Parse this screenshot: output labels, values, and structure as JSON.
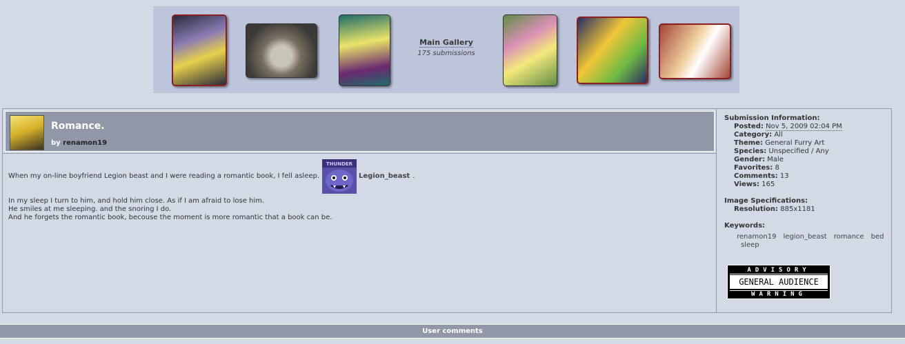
{
  "gallery": {
    "title": "Main Gallery",
    "count": "175 submissions",
    "thumbnails": [
      {
        "name": "thumb-1",
        "palette": [
          "#2a2c3a",
          "#e7d14a",
          "#8a7bb3"
        ]
      },
      {
        "name": "thumb-2",
        "palette": [
          "#3b3a36",
          "#c9c4b8",
          "#7a6f62"
        ]
      },
      {
        "name": "thumb-3",
        "palette": [
          "#1f6b6a",
          "#e9e46a",
          "#6a2a6f"
        ]
      },
      {
        "name": "thumb-4",
        "palette": [
          "#5f8e47",
          "#f3e97b",
          "#d990b5"
        ]
      },
      {
        "name": "thumb-5",
        "palette": [
          "#2a2f64",
          "#f0c637",
          "#6dbb43"
        ]
      },
      {
        "name": "thumb-6",
        "palette": [
          "#a24634",
          "#f1d3a3",
          "#ffffff"
        ]
      }
    ]
  },
  "submission": {
    "title": "Romance.",
    "by_prefix": "by",
    "author": "renamon19",
    "description": {
      "line1_before": "When my on-line boyfriend Legion beast and I were reading a romantic book, I fell asleep.",
      "linked_user": "Legion_beast",
      "line1_after": ".",
      "icon_text": "THUNDER",
      "lines": [
        "In my sleep I turn to him, and hold him close. As if I am afraid to lose him.",
        "He smiles at me sleeping. and the snoring I do.",
        "And he forgets the romantic book, becouse the moment is more romantic that a book can be."
      ]
    }
  },
  "info": {
    "heading": "Submission Information:",
    "rows": [
      {
        "label": "Posted:",
        "value": "Nov 5, 2009 02:04 PM"
      },
      {
        "label": "Category:",
        "value": "All"
      },
      {
        "label": "Theme:",
        "value": "General Furry Art"
      },
      {
        "label": "Species:",
        "value": "Unspecified / Any"
      },
      {
        "label": "Gender:",
        "value": "Male"
      },
      {
        "label": "Favorites:",
        "value": "8"
      },
      {
        "label": "Comments:",
        "value": "13"
      },
      {
        "label": "Views:",
        "value": "165"
      }
    ],
    "image_heading": "Image Specifications:",
    "resolution_label": "Resolution:",
    "resolution_value": "885x1181",
    "keywords_heading": "Keywords:",
    "keywords": [
      "renamon19",
      "legion_beast",
      "romance",
      "bed",
      "sleep"
    ]
  },
  "advisory": {
    "top": "ADVISORY",
    "middle": "GENERAL AUDIENCE",
    "bottom": "WARNING"
  },
  "comments_bar": "User comments"
}
